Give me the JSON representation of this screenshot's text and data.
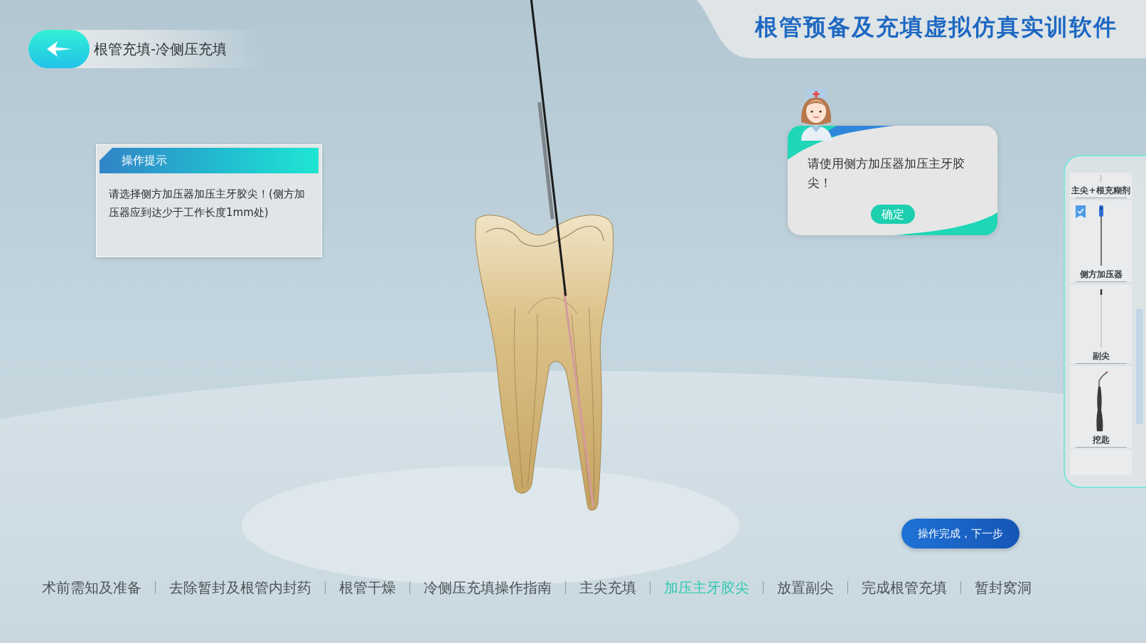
{
  "header": {
    "title": "根管充填-冷侧压充填"
  },
  "app_title": "根管预备及充填虚拟仿真实训软件",
  "tip_panel": {
    "title": "操作提示",
    "text": "请选择侧方加压器加压主牙胶尖！(侧方加压器应到达少于工作长度1mm处)"
  },
  "dialog": {
    "message": "请使用侧方加压器加压主牙胶尖！",
    "button": "确定"
  },
  "tools": [
    {
      "kind": "cone",
      "label": "主尖+根充糊剂",
      "checked": false
    },
    {
      "kind": "spreader",
      "label": "侧方加压器",
      "checked": true
    },
    {
      "kind": "accessory_cone",
      "label": "副尖",
      "checked": false
    },
    {
      "kind": "excavator",
      "label": "挖匙",
      "checked": false
    }
  ],
  "next_button": "操作完成，下一步",
  "steps": [
    {
      "label": "术前需知及准备",
      "selected": false
    },
    {
      "label": "去除暂封及根管内封药",
      "selected": false
    },
    {
      "label": "根管干燥",
      "selected": false
    },
    {
      "label": "冷侧压充填操作指南",
      "selected": false
    },
    {
      "label": "主尖充填",
      "selected": false
    },
    {
      "label": "加压主牙胶尖",
      "selected": true
    },
    {
      "label": "放置副尖",
      "selected": false
    },
    {
      "label": "完成根管充填",
      "selected": false
    },
    {
      "label": "暂封窝洞",
      "selected": false
    }
  ]
}
